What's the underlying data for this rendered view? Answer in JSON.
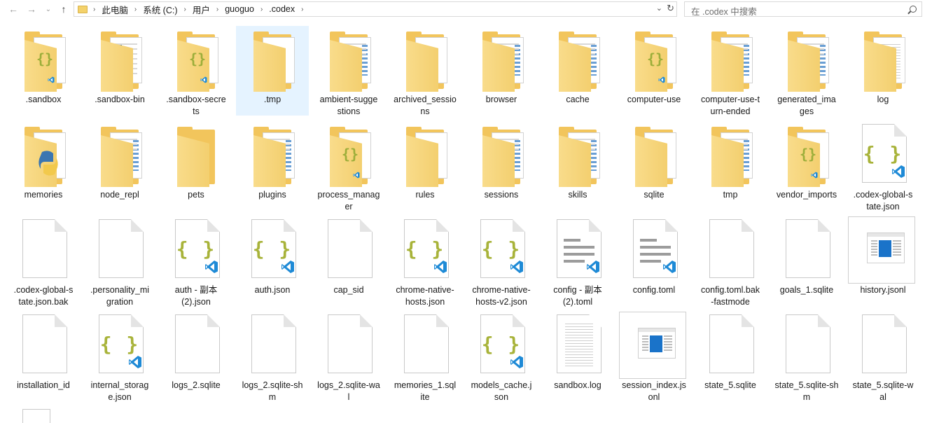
{
  "toolbar": {
    "back_icon": "back-arrow-icon",
    "forward_icon": "forward-arrow-icon",
    "recent_icon": "chevron-down-icon",
    "up_icon": "up-arrow-icon"
  },
  "breadcrumb": [
    "此电脑",
    "系统 (C:)",
    "用户",
    "guoguo",
    ".codex"
  ],
  "search": {
    "placeholder": "在 .codex 中搜索"
  },
  "items": [
    {
      "name": ".sandbox",
      "icon": "folder-json"
    },
    {
      "name": ".sandbox-bin",
      "icon": "folder-doc"
    },
    {
      "name": ".sandbox-secrets",
      "icon": "folder-json"
    },
    {
      "name": ".tmp",
      "icon": "folder-empty-paper",
      "selected": true
    },
    {
      "name": "ambient-suggestions",
      "icon": "folder-lines"
    },
    {
      "name": "archived_sessions",
      "icon": "folder-paper"
    },
    {
      "name": "browser",
      "icon": "folder-lines"
    },
    {
      "name": "cache",
      "icon": "folder-lines"
    },
    {
      "name": "computer-use",
      "icon": "folder-json"
    },
    {
      "name": "computer-use-turn-ended",
      "icon": "folder-lines"
    },
    {
      "name": "generated_images",
      "icon": "folder-lines"
    },
    {
      "name": "log",
      "icon": "folder-log"
    },
    {
      "name": "memories",
      "icon": "folder-python"
    },
    {
      "name": "node_repl",
      "icon": "folder-lines"
    },
    {
      "name": "pets",
      "icon": "folder-plain"
    },
    {
      "name": "plugins",
      "icon": "folder-lines"
    },
    {
      "name": "process_manager",
      "icon": "folder-json"
    },
    {
      "name": "rules",
      "icon": "folder-paper"
    },
    {
      "name": "sessions",
      "icon": "folder-lines"
    },
    {
      "name": "skills",
      "icon": "folder-lines"
    },
    {
      "name": "sqlite",
      "icon": "folder-paper"
    },
    {
      "name": "tmp",
      "icon": "folder-lines"
    },
    {
      "name": "vendor_imports",
      "icon": "folder-json"
    },
    {
      "name": ".codex-global-state.json",
      "icon": "file-json"
    },
    {
      "name": ".codex-global-state.json.bak",
      "icon": "file-blank"
    },
    {
      "name": ".personality_migration",
      "icon": "file-blank"
    },
    {
      "name": "auth - 副本 (2).json",
      "icon": "file-json"
    },
    {
      "name": "auth.json",
      "icon": "file-json"
    },
    {
      "name": "cap_sid",
      "icon": "file-blank"
    },
    {
      "name": "chrome-native-hosts.json",
      "icon": "file-json"
    },
    {
      "name": "chrome-native-hosts-v2.json",
      "icon": "file-json"
    },
    {
      "name": "config - 副本 (2).toml",
      "icon": "file-text"
    },
    {
      "name": "config.toml",
      "icon": "file-text"
    },
    {
      "name": "config.toml.bak-fastmode",
      "icon": "file-blank"
    },
    {
      "name": "goals_1.sqlite",
      "icon": "file-blank"
    },
    {
      "name": "history.jsonl",
      "icon": "file-window"
    },
    {
      "name": "installation_id",
      "icon": "file-blank"
    },
    {
      "name": "internal_storage.json",
      "icon": "file-json"
    },
    {
      "name": "logs_2.sqlite",
      "icon": "file-blank"
    },
    {
      "name": "logs_2.sqlite-shm",
      "icon": "file-blank"
    },
    {
      "name": "logs_2.sqlite-wal",
      "icon": "file-blank"
    },
    {
      "name": "memories_1.sqlite",
      "icon": "file-blank"
    },
    {
      "name": "models_cache.json",
      "icon": "file-json"
    },
    {
      "name": "sandbox.log",
      "icon": "file-log"
    },
    {
      "name": "session_index.jsonl",
      "icon": "file-window"
    },
    {
      "name": "state_5.sqlite",
      "icon": "file-blank"
    },
    {
      "name": "state_5.sqlite-shm",
      "icon": "file-blank"
    },
    {
      "name": "state_5.sqlite-wal",
      "icon": "file-blank"
    }
  ],
  "labels": {
    ".sandbox": [
      ".sandbox"
    ],
    ".sandbox-bin": [
      ".sandbox-bin"
    ],
    ".sandbox-secrets": [
      ".sandbox-secre",
      "ts"
    ],
    ".tmp": [
      ".tmp"
    ],
    "ambient-suggestions": [
      "ambient-sugge",
      "stions"
    ],
    "archived_sessions": [
      "archived_sessio",
      "ns"
    ],
    "computer-use-turn-ended": [
      "computer-use-t",
      "urn-ended"
    ],
    "generated_images": [
      "generated_ima",
      "ges"
    ],
    "process_manager": [
      "process_manag",
      "er"
    ],
    ".codex-global-state.json": [
      ".codex-global-s",
      "tate.json"
    ],
    ".codex-global-state.json.bak": [
      ".codex-global-s",
      "tate.json.bak"
    ],
    ".personality_migration": [
      ".personality_mi",
      "gration"
    ],
    "auth - 副本 (2).json": [
      "auth - 副本",
      "(2).json"
    ],
    "chrome-native-hosts.json": [
      "chrome-native-",
      "hosts.json"
    ],
    "chrome-native-hosts-v2.json": [
      "chrome-native-",
      "hosts-v2.json"
    ],
    "config - 副本 (2).toml": [
      "config - 副本",
      "(2).toml"
    ],
    "config.toml.bak-fastmode": [
      "config.toml.bak",
      "-fastmode"
    ],
    "internal_storage.json": [
      "internal_storag",
      "e.json"
    ],
    "logs_2.sqlite-shm": [
      "logs_2.sqlite-sh",
      "m"
    ],
    "logs_2.sqlite-wal": [
      "logs_2.sqlite-wa",
      "l"
    ],
    "memories_1.sqlite": [
      "memories_1.sql",
      "ite"
    ],
    "models_cache.json": [
      "models_cache.j",
      "son"
    ],
    "session_index.jsonl": [
      "session_index.js",
      "onl"
    ],
    "state_5.sqlite-shm": [
      "state_5.sqlite-sh",
      "m"
    ],
    "state_5.sqlite-wal": [
      "state_5.sqlite-w",
      "al"
    ]
  }
}
